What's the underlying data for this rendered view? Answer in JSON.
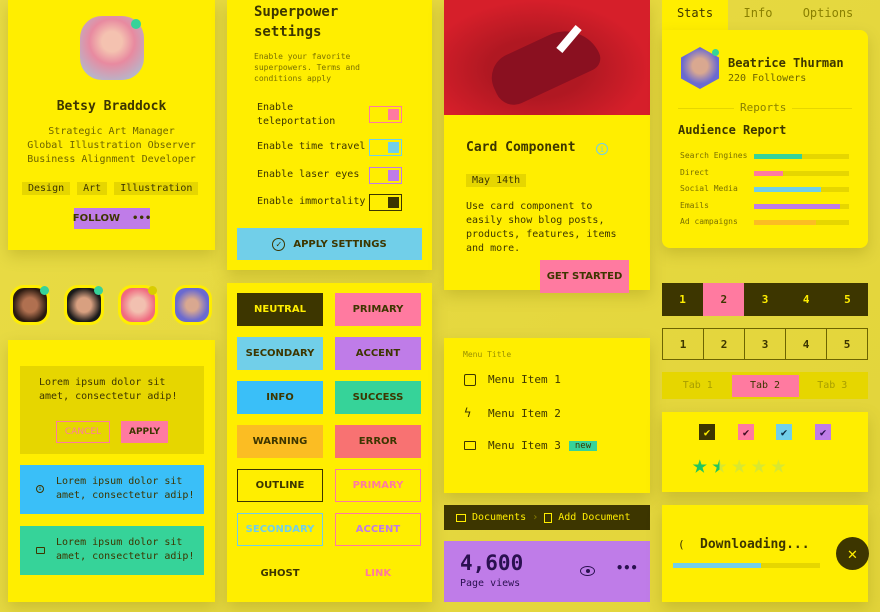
{
  "profile": {
    "name": "Betsy Braddock",
    "titles": [
      "Strategic Art Manager",
      "Global Illustration Observer",
      "Business Alignment Developer"
    ],
    "tags": [
      "Design",
      "Art",
      "Illustration"
    ],
    "follow": "FOLLOW",
    "more": "•••"
  },
  "settings": {
    "title": "Superpower settings",
    "desc": "Enable your favorite superpowers. Terms and conditions apply",
    "toggles": [
      {
        "label": "Enable teleportation",
        "on": true,
        "color": "#ff7aa0"
      },
      {
        "label": "Enable time travel",
        "on": true,
        "color": "#71cfe9"
      },
      {
        "label": "Enable laser eyes",
        "on": true,
        "color": "#bf7ce8"
      },
      {
        "label": "Enable immortality",
        "on": true,
        "color": "#3d3600"
      }
    ],
    "apply": "APPLY SETTINGS"
  },
  "product": {
    "title": "Card Component",
    "date": "May 14th",
    "desc": "Use card component to easily show blog posts, products, features, items and more.",
    "cta": "GET STARTED"
  },
  "stats": {
    "tabs": [
      "Stats",
      "Info",
      "Options"
    ],
    "active_tab": "Stats",
    "name": "Beatrice Thurman",
    "followers": "220 Followers",
    "divider": "Reports",
    "report_title": "Audience Report",
    "rows": [
      {
        "label": "Search Engines",
        "value": 50,
        "color": "#36d399"
      },
      {
        "label": "Direct",
        "value": 30,
        "color": "#ff7aa0"
      },
      {
        "label": "Social Media",
        "value": 70,
        "color": "#71cfe9"
      },
      {
        "label": "Emails",
        "value": 90,
        "color": "#bf7ce8"
      },
      {
        "label": "Ad campaigns",
        "value": 65,
        "color": "#fbbd23"
      }
    ]
  },
  "alerts": {
    "text1": "Lorem ipsum dolor sit amet, consectetur adip!",
    "cancel": "CANCEL",
    "apply": "APPLY",
    "text2": "Lorem ipsum dolor sit amet, consectetur adip!",
    "text3": "Lorem ipsum dolor sit amet, consectetur adip!"
  },
  "buttons": [
    "NEUTRAL",
    "PRIMARY",
    "SECONDARY",
    "ACCENT",
    "INFO",
    "SUCCESS",
    "WARNING",
    "ERROR",
    "OUTLINE",
    "PRIMARY",
    "SECONDARY",
    "ACCENT",
    "GHOST",
    "LINK"
  ],
  "menu": {
    "title": "Menu Title",
    "items": [
      "Menu Item 1",
      "Menu Item 2",
      "Menu Item 3"
    ],
    "badge": "new"
  },
  "breadcrumb": [
    "Documents",
    "Add Document"
  ],
  "stat": {
    "value": "4,600",
    "label": "Page views"
  },
  "pagination": [
    "1",
    "2",
    "3",
    "4",
    "5"
  ],
  "pagination_active": "2",
  "tabs": [
    "Tab 1",
    "Tab 2",
    "Tab 3"
  ],
  "tabs_active": "Tab 2",
  "rating": {
    "value": 1.5,
    "max": 5
  },
  "download": {
    "text": "Downloading...",
    "progress": 0.6
  },
  "colors": {
    "yellow": "#ffee00",
    "dark": "#3d3600",
    "pink": "#ff7aa0",
    "blue": "#71cfe9",
    "purple": "#bf7ce8",
    "green": "#36d399"
  }
}
